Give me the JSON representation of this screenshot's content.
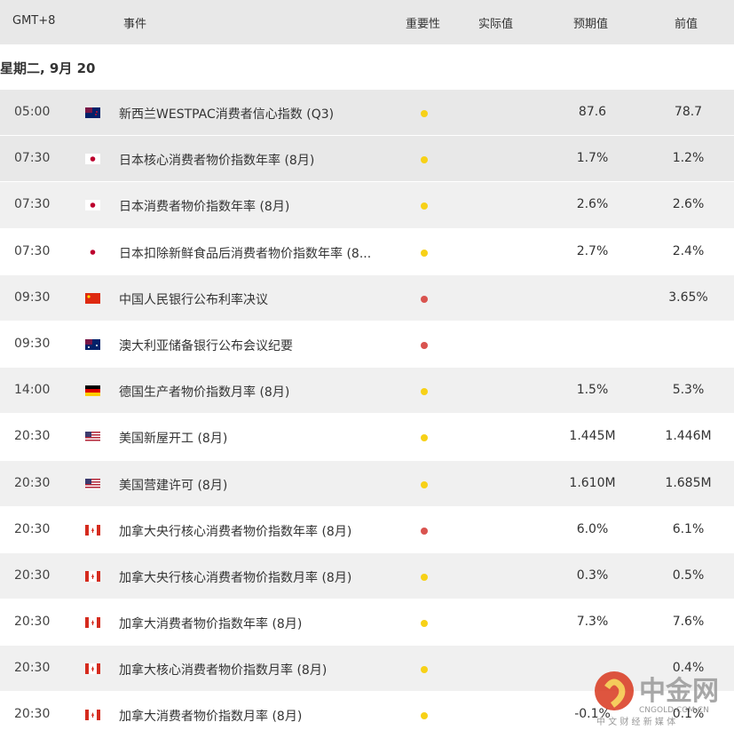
{
  "header": {
    "tz": "GMT+8",
    "event": "事件",
    "importance": "重要性",
    "actual": "实际值",
    "forecast": "预期值",
    "previous": "前值"
  },
  "date": "星期二, 9月 20",
  "colors": {
    "high": "#d9534f",
    "medium": "#f7d117"
  },
  "rows": [
    {
      "time": "05:00",
      "country": "new-zealand",
      "event": "新西兰WESTPAC消费者信心指数 (Q3)",
      "importance": "medium",
      "actual": "",
      "forecast": "87.6",
      "previous": "78.7"
    },
    {
      "time": "07:30",
      "country": "japan",
      "event": "日本核心消费者物价指数年率 (8月)",
      "importance": "medium",
      "actual": "",
      "forecast": "1.7%",
      "previous": "1.2%"
    },
    {
      "time": "07:30",
      "country": "japan",
      "event": "日本消费者物价指数年率 (8月)",
      "importance": "medium",
      "actual": "",
      "forecast": "2.6%",
      "previous": "2.6%"
    },
    {
      "time": "07:30",
      "country": "japan",
      "event": "日本扣除新鲜食品后消费者物价指数年率 (8...",
      "importance": "medium",
      "actual": "",
      "forecast": "2.7%",
      "previous": "2.4%"
    },
    {
      "time": "09:30",
      "country": "china",
      "event": "中国人民银行公布利率决议",
      "importance": "high",
      "actual": "",
      "forecast": "",
      "previous": "3.65%"
    },
    {
      "time": "09:30",
      "country": "australia",
      "event": "澳大利亚储备银行公布会议纪要",
      "importance": "high",
      "actual": "",
      "forecast": "",
      "previous": ""
    },
    {
      "time": "14:00",
      "country": "germany",
      "event": "德国生产者物价指数月率 (8月)",
      "importance": "medium",
      "actual": "",
      "forecast": "1.5%",
      "previous": "5.3%"
    },
    {
      "time": "20:30",
      "country": "usa",
      "event": "美国新屋开工 (8月)",
      "importance": "medium",
      "actual": "",
      "forecast": "1.445M",
      "previous": "1.446M"
    },
    {
      "time": "20:30",
      "country": "usa",
      "event": "美国营建许可 (8月)",
      "importance": "medium",
      "actual": "",
      "forecast": "1.610M",
      "previous": "1.685M"
    },
    {
      "time": "20:30",
      "country": "canada",
      "event": "加拿大央行核心消费者物价指数年率 (8月)",
      "importance": "high",
      "actual": "",
      "forecast": "6.0%",
      "previous": "6.1%"
    },
    {
      "time": "20:30",
      "country": "canada",
      "event": "加拿大央行核心消费者物价指数月率 (8月)",
      "importance": "medium",
      "actual": "",
      "forecast": "0.3%",
      "previous": "0.5%"
    },
    {
      "time": "20:30",
      "country": "canada",
      "event": "加拿大消费者物价指数年率 (8月)",
      "importance": "medium",
      "actual": "",
      "forecast": "7.3%",
      "previous": "7.6%"
    },
    {
      "time": "20:30",
      "country": "canada",
      "event": "加拿大核心消费者物价指数月率 (8月)",
      "importance": "medium",
      "actual": "",
      "forecast": "",
      "previous": "0.4%"
    },
    {
      "time": "20:30",
      "country": "canada",
      "event": "加拿大消费者物价指数月率 (8月)",
      "importance": "medium",
      "actual": "",
      "forecast": "-0.1%",
      "previous": "0.1%"
    }
  ],
  "watermark": {
    "name": "中金网",
    "domain": "CNGOLD.COM.CN",
    "tagline": "中 文 财 经 新 媒 体"
  }
}
